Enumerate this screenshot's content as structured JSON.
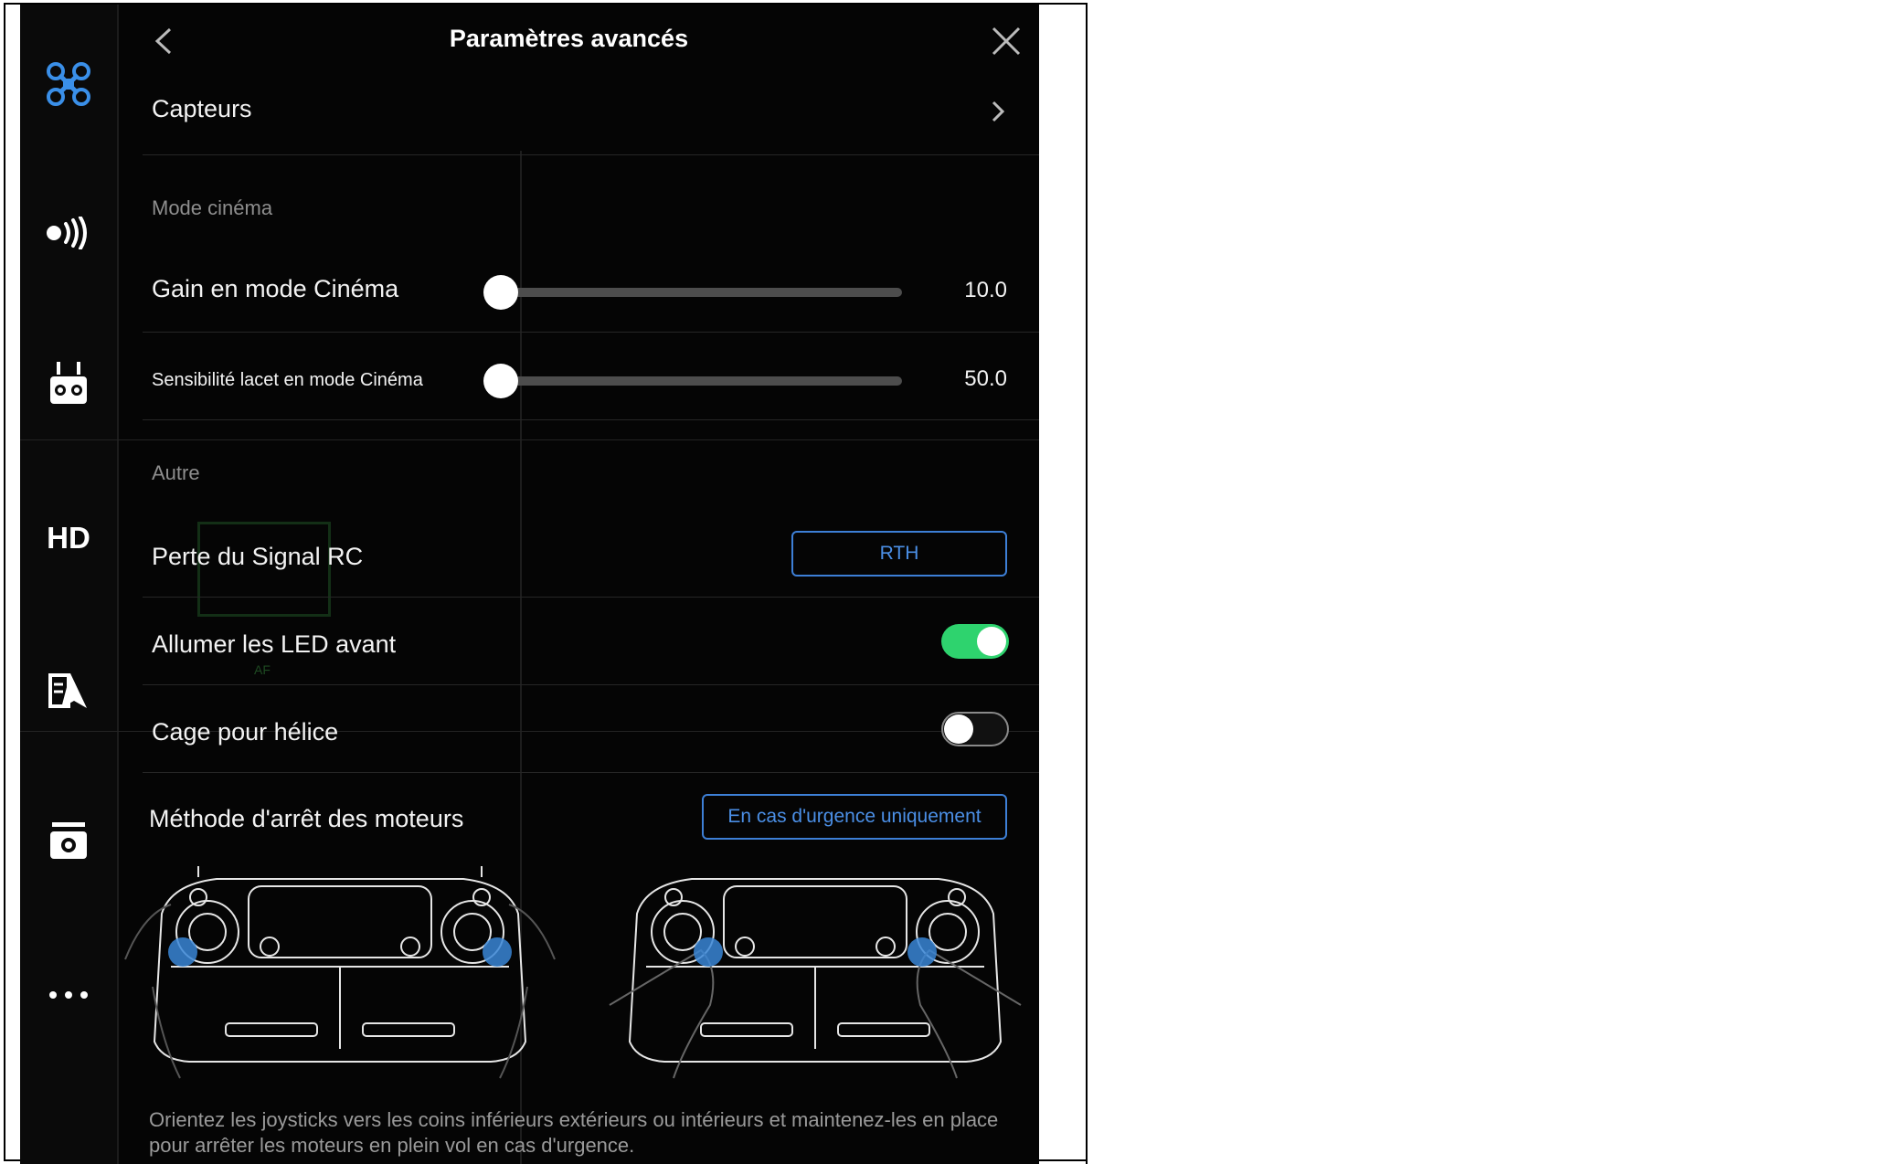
{
  "header": {
    "title": "Paramètres avancés"
  },
  "rail": {
    "items": [
      {
        "icon": "drone-icon",
        "active": true
      },
      {
        "icon": "signal-icon"
      },
      {
        "icon": "remote-controller-icon"
      },
      {
        "icon": "hd-icon",
        "label": "HD"
      },
      {
        "icon": "battery-map-icon"
      },
      {
        "icon": "camera-icon"
      },
      {
        "icon": "more-icon"
      }
    ]
  },
  "sensors": {
    "label": "Capteurs"
  },
  "cine": {
    "section": "Mode cinéma",
    "gain": {
      "label": "Gain en mode Cinéma",
      "value": "10.0"
    },
    "yaw": {
      "label": "Sensibilité lacet en mode Cinéma",
      "value": "50.0"
    }
  },
  "other": {
    "section": "Autre",
    "rc_loss": {
      "label": "Perte du Signal RC",
      "value": "RTH"
    },
    "front_led": {
      "label": "Allumer les LED avant",
      "on": true
    },
    "prop_guard": {
      "label": "Cage pour hélice",
      "on": false
    },
    "motor_stop": {
      "label": "Méthode d'arrêt des moteurs",
      "value": "En cas d'urgence uniquement"
    }
  },
  "description": "Orientez les joysticks vers les coins inférieurs extérieurs ou intérieurs et maintenez-les en place pour arrêter les moteurs en plein vol en cas d'urgence.",
  "background": {
    "af_label": "AF"
  },
  "colors": {
    "accent": "#3d7fd6",
    "toggle_on": "#2ed36e",
    "stick_blue": "#3a86d6"
  }
}
